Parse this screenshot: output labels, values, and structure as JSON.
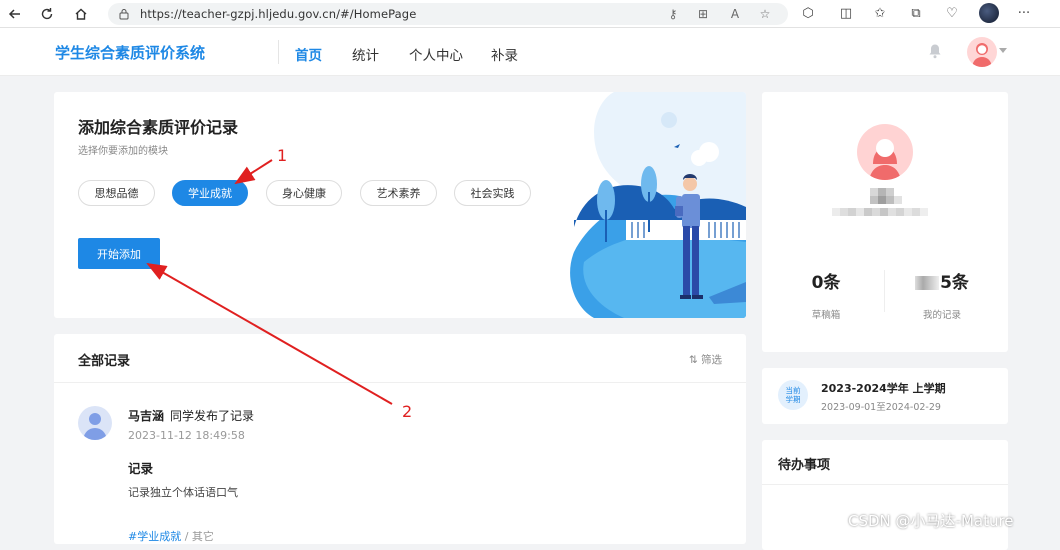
{
  "browser": {
    "url": "https://teacher-gzpj.hljedu.gov.cn/#/HomePage",
    "more_label": "···"
  },
  "header": {
    "app_title": "学生综合素质评价系统",
    "nav": [
      {
        "label": "首页",
        "active": true
      },
      {
        "label": "统计",
        "active": false
      },
      {
        "label": "个人中心",
        "active": false
      },
      {
        "label": "补录",
        "active": false
      }
    ]
  },
  "add_card": {
    "title": "添加综合素质评价记录",
    "subtitle": "选择你要添加的模块",
    "modules": [
      {
        "label": "思想品德",
        "active": false
      },
      {
        "label": "学业成就",
        "active": true
      },
      {
        "label": "身心健康",
        "active": false
      },
      {
        "label": "艺术素养",
        "active": false
      },
      {
        "label": "社会实践",
        "active": false
      }
    ],
    "start_button": "开始添加"
  },
  "records": {
    "title": "全部记录",
    "filter": "⇅ 筛选",
    "items": [
      {
        "name": "马吉涵",
        "action": "同学发布了记录",
        "time": "2023-11-12 18:49:58",
        "subject": "记录",
        "content": "记录独立个体话语口气",
        "tag": "#学业成就",
        "tag_sep": " / ",
        "tag_other": "其它"
      }
    ]
  },
  "profile": {
    "drafts_count": "0条",
    "drafts_label": "草稿箱",
    "my_records_count": "5条",
    "my_records_label": "我的记录"
  },
  "term": {
    "badge_line1": "当前",
    "badge_line2": "学期",
    "title": "2023-2024学年 上学期",
    "range": "2023-09-01至2024-02-29"
  },
  "todo": {
    "title": "待办事项"
  },
  "annotations": {
    "label_1": "1",
    "label_2": "2"
  },
  "watermark": "CSDN @小马达-Mature",
  "colors": {
    "accent": "#1e88e5",
    "annotation": "#e02020",
    "page_bg": "#f2f3f5"
  }
}
